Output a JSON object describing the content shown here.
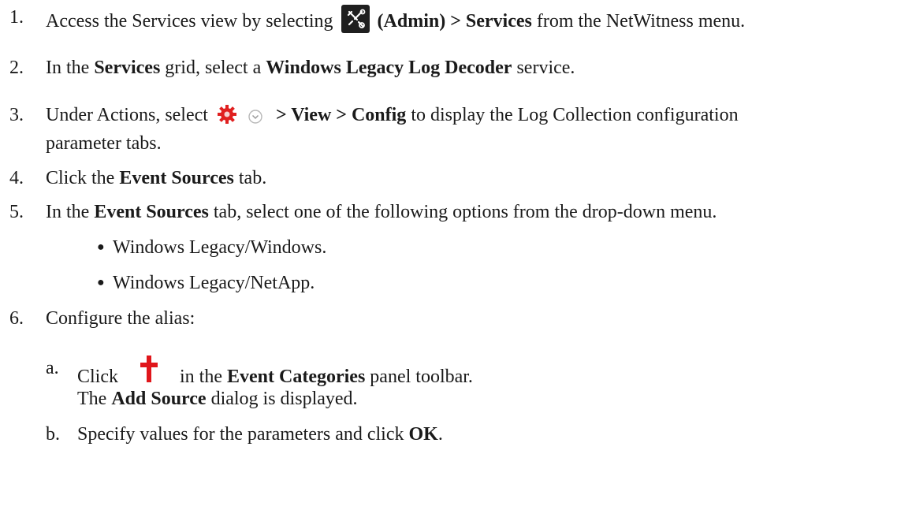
{
  "steps": [
    {
      "num": "1.",
      "pre": "Access the Services view by selecting",
      "bold1": "(Admin) > Services",
      "post": "from the NetWitness menu."
    },
    {
      "num": "2.",
      "pre": "In the",
      "bold1": "Services",
      "mid": "grid, select a",
      "bold2": "Windows Legacy Log Decoder",
      "post": "service."
    },
    {
      "num": "3.",
      "pre": "Under Actions, select",
      "bold1": "> View > Config",
      "post": "to display the Log Collection configuration",
      "cont": "parameter tabs."
    },
    {
      "num": "4.",
      "pre": "Click the",
      "bold1": "Event Sources",
      "post": "tab."
    },
    {
      "num": "5.",
      "pre": "In the",
      "bold1": "Event Sources",
      "post": "tab, select one of the following options from the drop-down menu."
    },
    {
      "num": "6.",
      "pre": "Configure the alias:"
    }
  ],
  "bullets": [
    "Windows Legacy/Windows.",
    "Windows Legacy/NetApp."
  ],
  "substeps": [
    {
      "letter": "a.",
      "pre": "Click",
      "mid": "in the",
      "bold1": "Event Categories",
      "post": "panel toolbar.",
      "cont_pre": "The",
      "cont_bold": "Add Source",
      "cont_post": "dialog is displayed."
    },
    {
      "letter": "b.",
      "pre": "Specify values for the parameters and click",
      "bold1": "OK",
      "post": "."
    }
  ],
  "icons": {
    "admin": "admin-tools-icon",
    "gear": "gear-icon",
    "chevron": "chevron-down-icon",
    "plus": "plus-icon",
    "gear_color": "#e02020",
    "plus_color": "#e0161b"
  }
}
